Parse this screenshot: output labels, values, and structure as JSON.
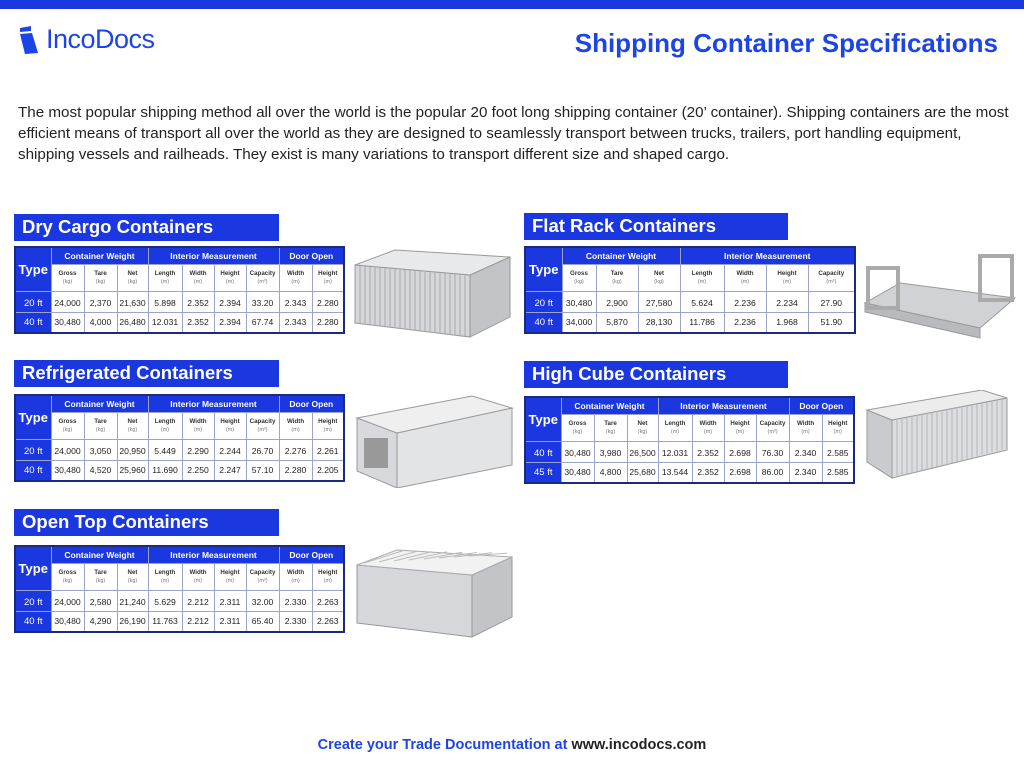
{
  "brand": {
    "name": "IncoDocs",
    "accent": "#1a37e0"
  },
  "title": "Shipping Container Specifications",
  "intro": "The most popular shipping method all over the world is the popular 20 foot long shipping container (20’ container).  Shipping containers are the most efficient means of transport all over the world as they are designed to seamlessly transport between trucks, trailers, port handling equipment, shipping vessels and railheads.  They exist is many variations to transport different size and shaped cargo.",
  "footer": {
    "text": "Create your Trade Documentation at",
    "link": "www.incodocs.com"
  },
  "groups_full": [
    {
      "label": "Container Weight",
      "span": 3
    },
    {
      "label": "Interior Measurement",
      "span": 4
    },
    {
      "label": "Door Open",
      "span": 2
    }
  ],
  "groups_nodoor": [
    {
      "label": "Container Weight",
      "span": 3
    },
    {
      "label": "Interior Measurement",
      "span": 4
    }
  ],
  "columns_full": [
    [
      "Gross",
      "(kg)"
    ],
    [
      "Tare",
      "(kg)"
    ],
    [
      "Net",
      "(kg)"
    ],
    [
      "Length",
      "(m)"
    ],
    [
      "Width",
      "(m)"
    ],
    [
      "Height",
      "(m)"
    ],
    [
      "Capacity",
      "(m³)"
    ],
    [
      "Width",
      "(m)"
    ],
    [
      "Height",
      "(m)"
    ]
  ],
  "type_label": "Type",
  "sections": [
    {
      "id": "dry",
      "title": "Dry Cargo Containers",
      "door": true,
      "image": "container-20ft-icon",
      "rows": [
        [
          "20 ft",
          "24,000",
          "2,370",
          "21,630",
          "5.898",
          "2.352",
          "2.394",
          "33.20",
          "2.343",
          "2.280"
        ],
        [
          "40 ft",
          "30,480",
          "4,000",
          "26,480",
          "12.031",
          "2.352",
          "2.394",
          "67.74",
          "2.343",
          "2.280"
        ]
      ]
    },
    {
      "id": "reefer",
      "title": "Refrigerated Containers",
      "door": true,
      "image": "reefer-container-icon",
      "rows": [
        [
          "20 ft",
          "24,000",
          "3,050",
          "20,950",
          "5.449",
          "2.290",
          "2.244",
          "26.70",
          "2.276",
          "2.261"
        ],
        [
          "40 ft",
          "30,480",
          "4,520",
          "25,960",
          "11.690",
          "2.250",
          "2.247",
          "57.10",
          "2.280",
          "2.205"
        ]
      ]
    },
    {
      "id": "opentop",
      "title": "Open Top Containers",
      "door": true,
      "image": "open-top-container-icon",
      "rows": [
        [
          "20 ft",
          "24,000",
          "2,580",
          "21,240",
          "5.629",
          "2.212",
          "2.311",
          "32.00",
          "2.330",
          "2.263"
        ],
        [
          "40 ft",
          "30,480",
          "4,290",
          "26,190",
          "11.763",
          "2.212",
          "2.311",
          "65.40",
          "2.330",
          "2.263"
        ]
      ]
    },
    {
      "id": "flatrack",
      "title": "Flat Rack Containers",
      "door": false,
      "image": "flat-rack-container-icon",
      "rows": [
        [
          "20 ft",
          "30,480",
          "2,900",
          "27,580",
          "5.624",
          "2.236",
          "2.234",
          "27.90"
        ],
        [
          "40 ft",
          "34,000",
          "5,870",
          "28,130",
          "11.786",
          "2.236",
          "1.968",
          "51.90"
        ]
      ]
    },
    {
      "id": "highcube",
      "title": "High Cube Containers",
      "door": true,
      "image": "high-cube-container-icon",
      "rows": [
        [
          "40 ft",
          "30,480",
          "3,980",
          "26,500",
          "12.031",
          "2.352",
          "2.698",
          "76.30",
          "2.340",
          "2.585"
        ],
        [
          "45 ft",
          "30,480",
          "4,800",
          "25,680",
          "13.544",
          "2.352",
          "2.698",
          "86.00",
          "2.340",
          "2.585"
        ]
      ]
    }
  ]
}
